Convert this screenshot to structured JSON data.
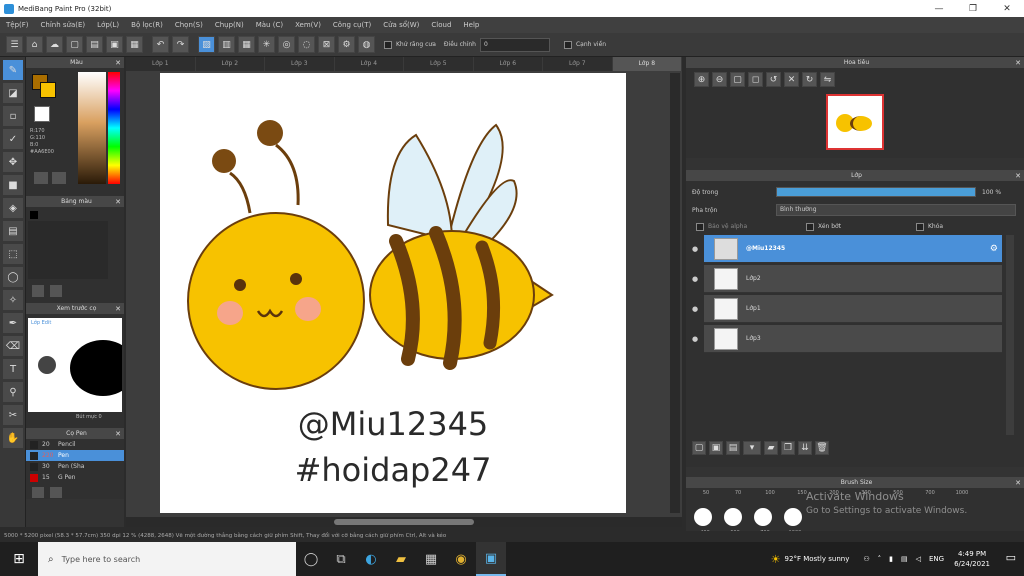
{
  "window": {
    "title": "MediBang Paint Pro (32bit)",
    "minimize": "—",
    "maximize": "❐",
    "close": "✕"
  },
  "menu": [
    "Tệp(F)",
    "Chỉnh sửa(E)",
    "Lớp(L)",
    "Bộ lọc(R)",
    "Chọn(S)",
    "Chụp(N)",
    "Màu (C)",
    "Xem(V)",
    "Công cụ(T)",
    "Cửa sổ(W)",
    "Cloud",
    "Help"
  ],
  "toolbar": {
    "antialias_label": "Khử răng cưa",
    "correction_label": "Điều chỉnh",
    "correction_value": "0",
    "edge_label": "Cạnh viền"
  },
  "panels": {
    "color": {
      "title": "Màu",
      "r": "R:170",
      "g": "G:110",
      "b": "B:0",
      "hex": "#AA6E00"
    },
    "brush_palette": {
      "title": "Bảng màu"
    },
    "brush_preview": {
      "title": "Xem trước cọ",
      "label": "Lớp Edit",
      "label2": "Bút mực 0"
    },
    "brush": {
      "title": "Cọ Pen",
      "items": [
        {
          "size": "20",
          "name": "Pencil"
        },
        {
          "size": "220",
          "name": "Pen"
        },
        {
          "size": "30",
          "name": "Pen (Sha"
        },
        {
          "size": "15",
          "name": "G Pen"
        }
      ]
    },
    "navigator": {
      "title": "Hoa tiêu"
    },
    "layer": {
      "title": "Lớp",
      "opacity_label": "Độ trong",
      "opacity_value": "100 %",
      "opacity": 1.0,
      "blend_label": "Pha trộn",
      "blend_value": "Bình thường",
      "protect_alpha": "Bảo vệ alpha",
      "clipping": "Xén bớt",
      "lock": "Khóa",
      "layers": [
        {
          "name": "@Miu12345",
          "selected": true
        },
        {
          "name": "Lớp2",
          "selected": false
        },
        {
          "name": "Lớp1",
          "selected": false
        },
        {
          "name": "Lớp3",
          "selected": false
        }
      ]
    },
    "brush_size": {
      "title": "Brush Size",
      "top_values": [
        "50",
        "70",
        "100",
        "150",
        "200",
        "300",
        "500",
        "700",
        "1000"
      ],
      "bottom_values": [
        "400",
        "600",
        "700",
        "1000"
      ]
    }
  },
  "canvas": {
    "tabs": [
      "Lớp 1",
      "Lớp 2",
      "Lớp 3",
      "Lớp 4",
      "Lớp 5",
      "Lớp 6",
      "Lớp 7",
      "Lớp 8"
    ],
    "line1": "@Miu12345",
    "line2": "#hoidap247"
  },
  "status": "5000 * 5200 pixel  (58.3 * 57.7cm)  350 dpi  12 %  (4288, 2648)  Vẽ một đường thẳng bằng cách giữ phím Shift, Thay đổi với cỡ bằng cách giữ phím Ctrl, Alt và kéo",
  "watermark": {
    "line1": "Activate Windows",
    "line2": "Go to Settings to activate Windows."
  },
  "taskbar": {
    "search_placeholder": "Type here to search",
    "weather": "92°F  Mostly sunny",
    "lang": "ENG",
    "time": "4:49 PM",
    "date": "6/24/2021"
  },
  "colors": {
    "accent": "#4a90d9",
    "bee_yellow": "#f7c200",
    "bee_stripe": "#6b3e0c",
    "wing": "#dff0f8",
    "cheek": "#f6a58a",
    "fg_swatch": "#aa6e00"
  }
}
